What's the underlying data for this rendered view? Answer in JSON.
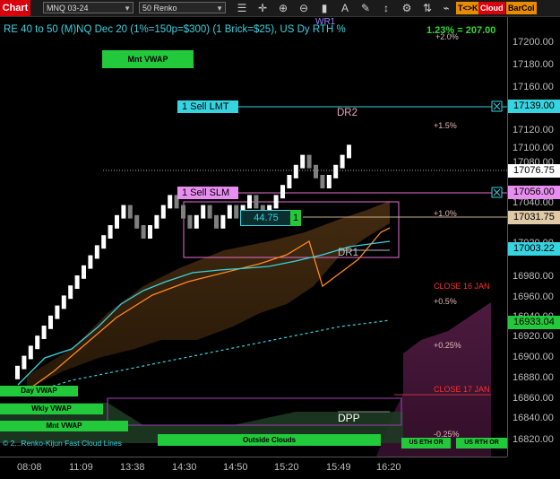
{
  "toolbar": {
    "chart_label": "Chart",
    "symbol": "MNQ 03-24",
    "interval": "50 Renko",
    "icons": [
      "menu-icon",
      "crosshair-icon",
      "zoom-in-icon",
      "zoom-out-icon",
      "bar-style-icon",
      "text-icon",
      "drawing-icon",
      "scale-icon",
      "properties-icon"
    ],
    "buttons": [
      {
        "label": "T<>K",
        "bg": "#e88b00",
        "fg": "#000000"
      },
      {
        "label": "Cloud",
        "bg": "#d8000c",
        "fg": "#ffffff"
      },
      {
        "label": "BarCol",
        "bg": "#e88b00",
        "fg": "#000000"
      }
    ]
  },
  "chart": {
    "title": "RE 40 to 50 (M)NQ Dec 20 (1%=150p=$300) (1 Brick=$25), US Dy RTH %",
    "wr1": "WR1",
    "top_pct_small": "+2.0%",
    "top_pct": "1.23% = 207.00",
    "mnt_vwap_top": "Mnt VWAP",
    "sell_lmt_label": "1 Sell LMT",
    "sell_slm_label": "1 Sell SLM",
    "dr2": "DR2",
    "dr1": "DR1",
    "dpp": "DPP",
    "plus_1_5": "+1.5%",
    "plus_1_0": "+1.0%",
    "plus_0_5": "+0.5%",
    "plus_0_25": "+0.25%",
    "minus_0_25": "-0.25%",
    "close_16": "CLOSE 16 JAN",
    "close_17": "CLOSE 17 JAN",
    "brick_value": "44.75",
    "brick_count": "1",
    "day_vwap": "Day VWAP",
    "wkly_vwap": "Wkly VWAP",
    "mnt_vwap_bottom": "Mnt VWAP",
    "copyright": "© 2...Renko-Kijun Fast Cloud Lines",
    "outside_clouds": "Outside Clouds",
    "us_eth_or": "US ETH OR",
    "us_rth_or": "US RTH OR"
  },
  "price_axis": {
    "labels": [
      "17200.00",
      "17180.00",
      "17160.00",
      "17120.00",
      "17100.00",
      "17080.00",
      "17040.00",
      "17020.00",
      "16980.00",
      "16960.00",
      "16940.00",
      "16920.00",
      "16900.00",
      "16880.00",
      "16860.00",
      "16840.00",
      "16820.00"
    ],
    "tags": [
      {
        "value": "17139.00",
        "bg": "#37d3e0"
      },
      {
        "value": "17076.75",
        "bg": "#ffffff"
      },
      {
        "value": "17056.00",
        "bg": "#e88ef0"
      },
      {
        "value": "17031.75",
        "bg": "#e0c9a6"
      },
      {
        "value": "17003.22",
        "bg": "#37d3e0"
      },
      {
        "value": "16933.04",
        "bg": "#22c93b"
      }
    ]
  },
  "time_axis": {
    "labels": [
      "08:08",
      "11:09",
      "13:38",
      "14:30",
      "14:50",
      "15:20",
      "15:49",
      "16:20"
    ]
  },
  "colors": {
    "up_brick": "#ffffff",
    "down_brick": "#808080",
    "cyan": "#37d3e0",
    "orange": "#ff8a1c",
    "pink": "#e86fcf",
    "green": "#22c93b",
    "red": "#ff2020"
  }
}
